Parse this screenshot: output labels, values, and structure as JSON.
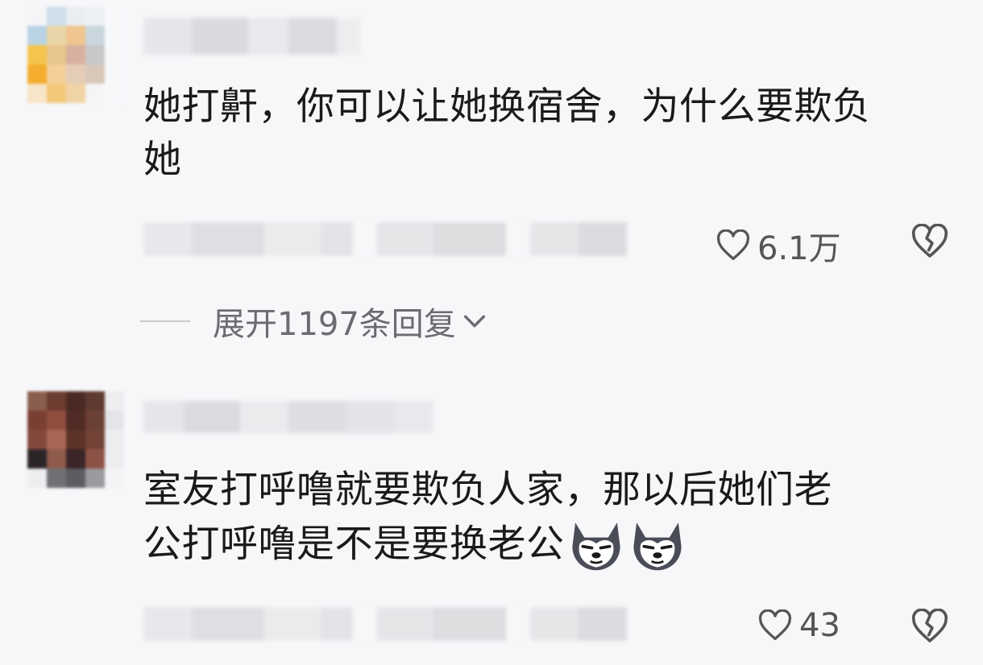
{
  "comments": [
    {
      "text_line1": "她打鼾，你可以让她换宿舍，为什么要欺负",
      "text_line2": "她",
      "likes": "6.1万",
      "like_icon": "heart-outline-icon",
      "dislike_icon": "broken-heart-icon"
    },
    {
      "text_line1": "室友打呼噜就要欺负人家，那以后她们老",
      "text_line2": "公打呼噜是不是要换老公",
      "likes": "43",
      "emojis": [
        "husky-dog-emoji",
        "husky-dog-emoji"
      ],
      "like_icon": "heart-outline-icon",
      "dislike_icon": "broken-heart-icon"
    }
  ],
  "expand_replies": {
    "label": "展开1197条回复",
    "icon": "chevron-down-icon"
  },
  "colors": {
    "background": "#f7f7f9",
    "text": "#1a1a1a",
    "muted": "#6b6b70",
    "icon": "#555555"
  }
}
